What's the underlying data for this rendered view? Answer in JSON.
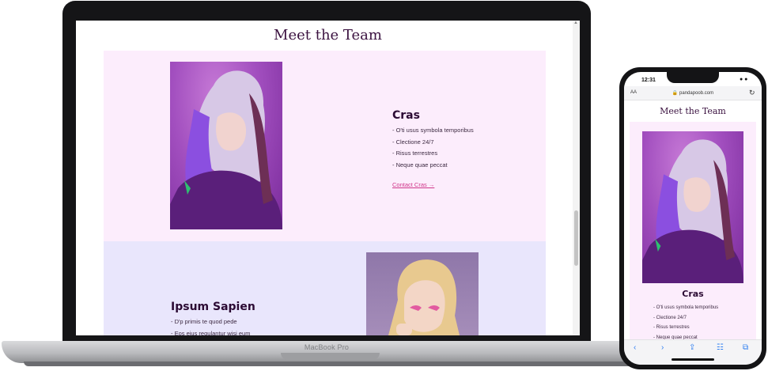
{
  "laptop": {
    "model_label": "MacBook Pro",
    "page": {
      "title": "Meet the Team",
      "members": [
        {
          "name": "Cras",
          "items": [
            "- O'ti usus symbola temporibus",
            "- Clectione 24/7",
            "- Risus terrestres",
            "- Neque quae peccat"
          ],
          "contact_label": "Contact Cras →"
        },
        {
          "name": "Ipsum Sapien",
          "items": [
            "- D'p primis te quod pede",
            "- Eos eius regulantur wisi eum"
          ]
        }
      ]
    }
  },
  "phone": {
    "time": "12:31",
    "status_icons": "● ●",
    "aa_label": "AA",
    "url": "🔒 pandapoob.com",
    "reload_icon": "↻",
    "page": {
      "title": "Meet the Team",
      "member": {
        "name": "Cras",
        "items": [
          "- O'ti usus symbola temporibus",
          "- Clectione 24/7",
          "- Risus terrestres",
          "- Neque quae peccat"
        ]
      }
    },
    "toolbar": {
      "back": "‹",
      "forward": "›",
      "share": "⇪",
      "bookmarks": "☷",
      "tabs": "⧉"
    }
  },
  "colors": {
    "accent": "#d0368a",
    "heading": "#3b1240",
    "section_pink": "#fcedfc",
    "section_lavender": "#e9e6fc"
  },
  "icons": [
    "lock-icon",
    "reload-icon",
    "back-icon",
    "forward-icon",
    "share-icon",
    "bookmarks-icon",
    "tabs-icon"
  ]
}
